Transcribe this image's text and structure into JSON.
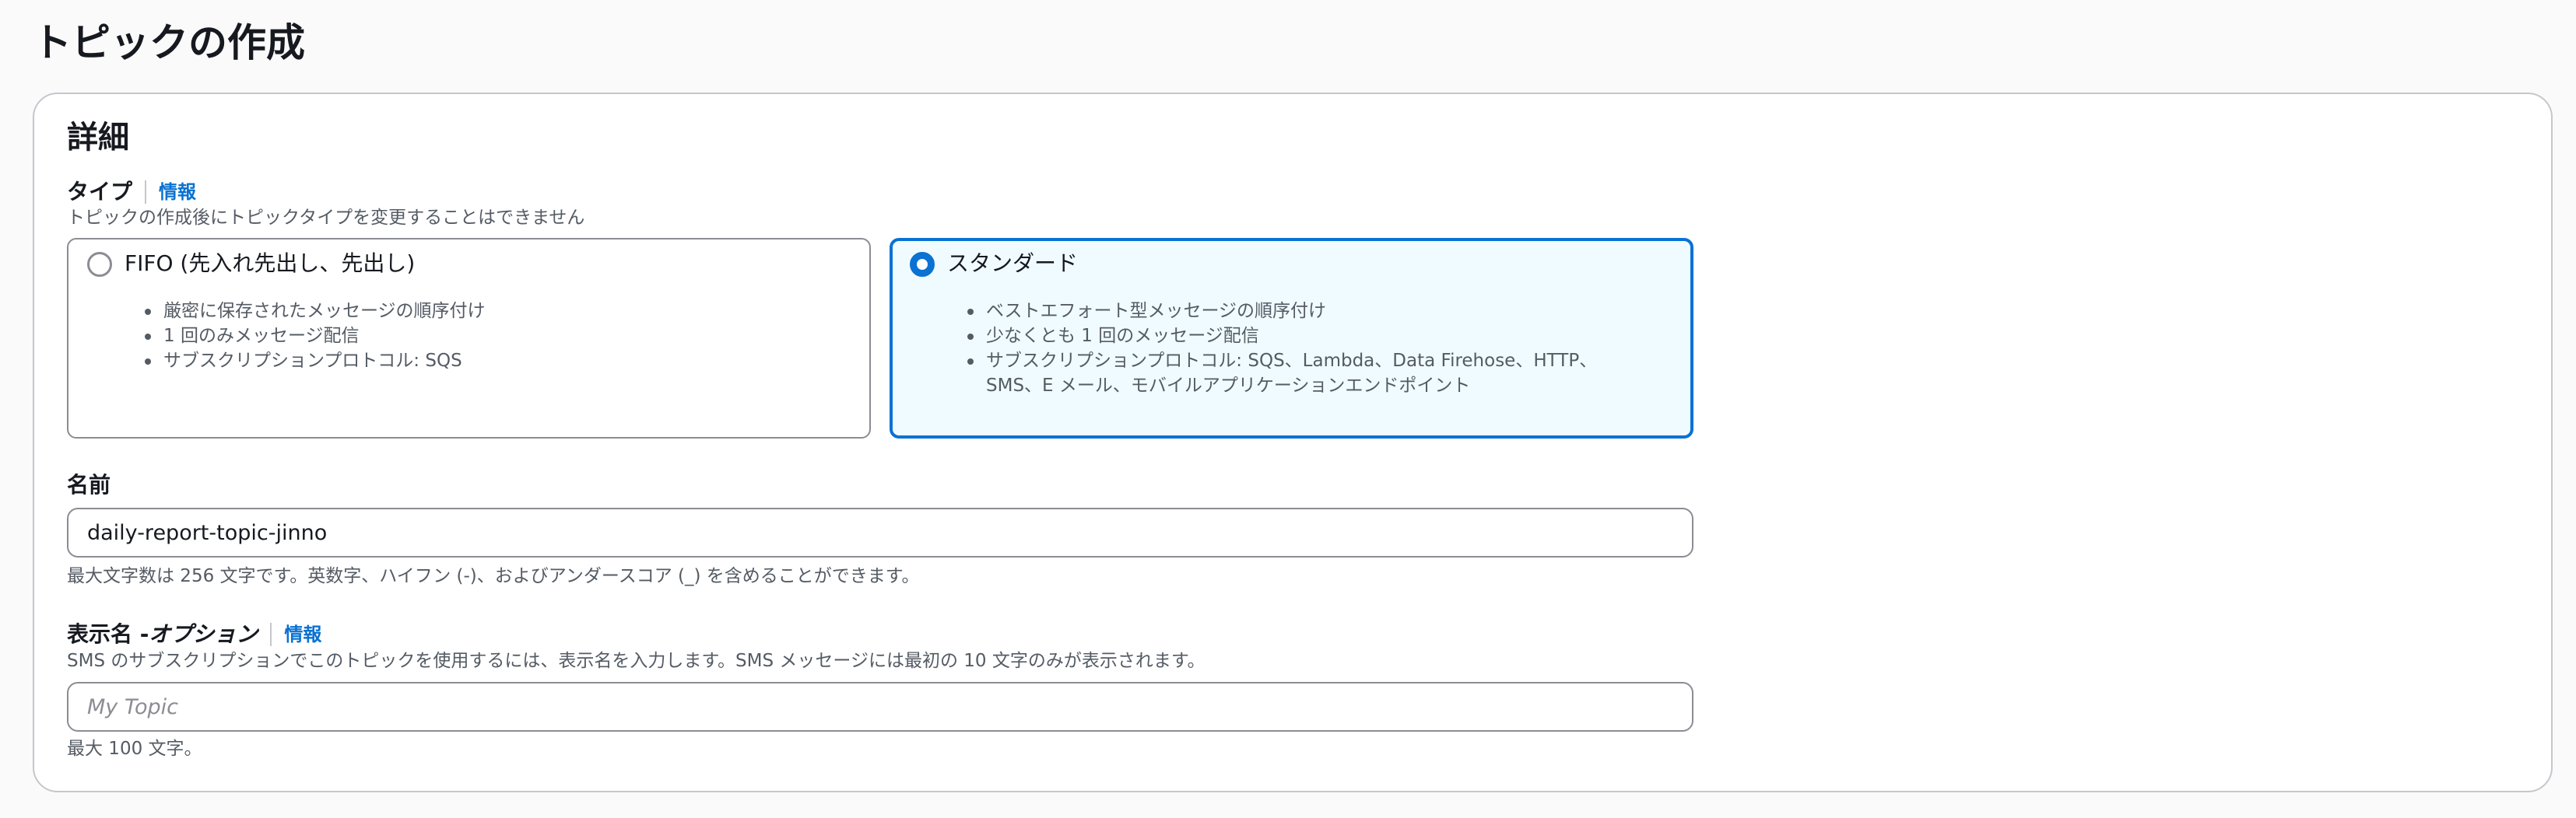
{
  "page": {
    "title": "トピックの作成"
  },
  "details": {
    "heading": "詳細",
    "type": {
      "label": "タイプ",
      "info": "情報",
      "description": "トピックの作成後にトピックタイプを変更することはできません",
      "selected": "standard",
      "options": [
        {
          "id": "fifo",
          "title": "FIFO (先入れ先出し、先出し)",
          "bullets": [
            "厳密に保存されたメッセージの順序付け",
            "1 回のみメッセージ配信",
            "サブスクリプションプロトコル: SQS"
          ]
        },
        {
          "id": "standard",
          "title": "スタンダード",
          "bullets": [
            "ベストエフォート型メッセージの順序付け",
            "少なくとも 1 回のメッセージ配信",
            "サブスクリプションプロトコル: SQS、Lambda、Data Firehose、HTTP、",
            "SMS、E メール、モバイルアプリケーションエンドポイント"
          ]
        }
      ]
    },
    "name": {
      "label": "名前",
      "value": "daily-report-topic-jinno",
      "hint": "最大文字数は 256 文字です。英数字、ハイフン (-)、およびアンダースコア (_) を含めることができます。"
    },
    "display_name": {
      "label": "表示名 - ",
      "label_optional": "オプション",
      "info": "情報",
      "description": "SMS のサブスクリプションでこのトピックを使用するには、表示名を入力します。SMS メッセージには最初の 10 文字のみが表示されます。",
      "value": "",
      "placeholder": "My Topic",
      "hint": "最大 100 文字。"
    }
  },
  "colors": {
    "accent": "#0972d3",
    "selected_tile_bg": "#f0fbff",
    "border": "#8c8c94",
    "secondary_text": "#545b64"
  }
}
